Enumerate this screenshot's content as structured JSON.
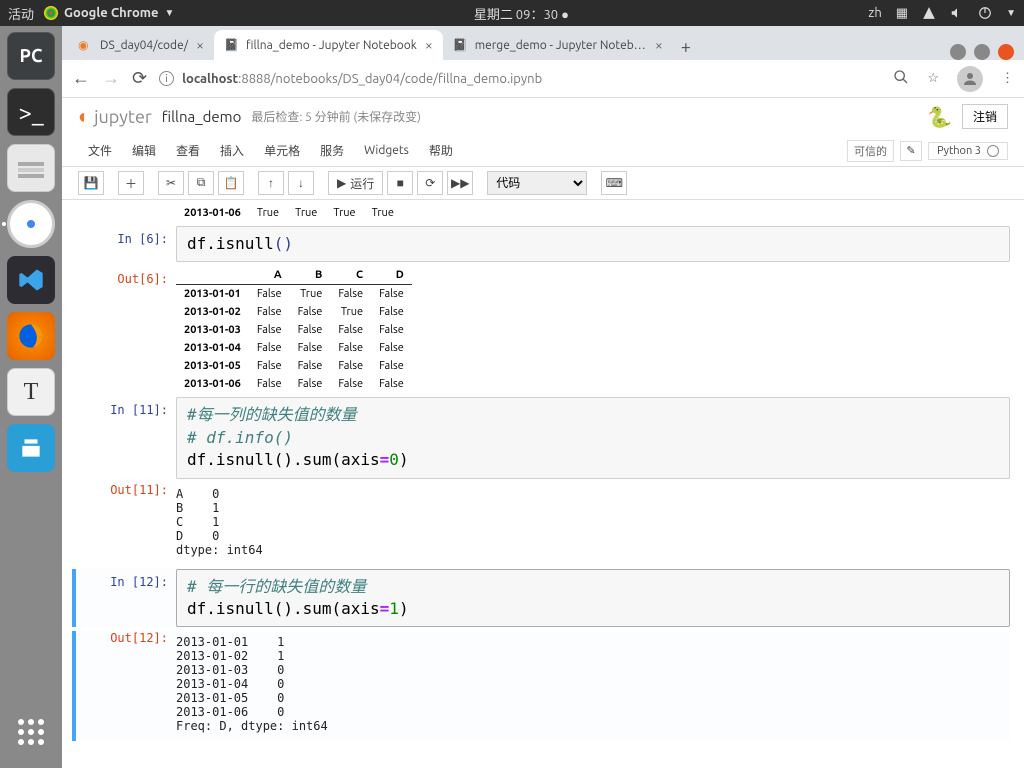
{
  "topbar": {
    "activities": "活动",
    "app_name": "Google Chrome",
    "datetime": "星期二 09：30",
    "lang": "zh"
  },
  "launcher": {
    "pycharm_label": "PC"
  },
  "chrome": {
    "tabs": [
      {
        "title": "DS_day04/code/",
        "favicon_color": "#f37626"
      },
      {
        "title": "fillna_demo - Jupyter Notebook",
        "favicon_color": "#f37626",
        "active": true
      },
      {
        "title": "merge_demo - Jupyter Notebook",
        "favicon_color": "#f37626"
      }
    ],
    "url_host": "localhost",
    "url_port": ":8888",
    "url_path": "/notebooks/DS_day04/code/fillna_demo.ipynb"
  },
  "jupyter": {
    "logo_text": "jupyter",
    "nb_title": "fillna_demo",
    "checkpoint": "最后检查: 5 分钟前",
    "unsaved": "(未保存改变)",
    "logout": "注销",
    "menus": [
      "文件",
      "编辑",
      "查看",
      "插入",
      "单元格",
      "服务",
      "Widgets",
      "帮助"
    ],
    "trusted": "可信的",
    "kernel": "Python 3",
    "run_label": "运行",
    "cell_type": "代码"
  },
  "cells": {
    "partial_out_row": {
      "date": "2013-01-06",
      "A": "True",
      "B": "True",
      "C": "True",
      "D": "True"
    },
    "c6": {
      "in_prompt": "In [6]:",
      "out_prompt": "Out[6]:",
      "code": "df.isnull()",
      "table": {
        "cols": [
          "A",
          "B",
          "C",
          "D"
        ],
        "rows": [
          {
            "idx": "2013-01-01",
            "v": [
              "False",
              "True",
              "False",
              "False"
            ]
          },
          {
            "idx": "2013-01-02",
            "v": [
              "False",
              "False",
              "True",
              "False"
            ]
          },
          {
            "idx": "2013-01-03",
            "v": [
              "False",
              "False",
              "False",
              "False"
            ]
          },
          {
            "idx": "2013-01-04",
            "v": [
              "False",
              "False",
              "False",
              "False"
            ]
          },
          {
            "idx": "2013-01-05",
            "v": [
              "False",
              "False",
              "False",
              "False"
            ]
          },
          {
            "idx": "2013-01-06",
            "v": [
              "False",
              "False",
              "False",
              "False"
            ]
          }
        ]
      }
    },
    "c11": {
      "in_prompt": "In [11]:",
      "out_prompt": "Out[11]:",
      "comment1": "#每一列的缺失值的数量",
      "comment2": "# df.info()",
      "code_prefix": "df.isnull().sum(axis",
      "code_eq": "=",
      "code_arg": "0",
      "code_suffix": ")",
      "output": "A    0\nB    1\nC    1\nD    0\ndtype: int64"
    },
    "c12": {
      "in_prompt": "In [12]:",
      "out_prompt": "Out[12]:",
      "comment1": "# 每一行的缺失值的数量",
      "code_prefix": "df.isnull().sum(axis",
      "code_eq": "=",
      "code_arg": "1",
      "code_suffix": ")",
      "output": "2013-01-01    1\n2013-01-02    1\n2013-01-03    0\n2013-01-04    0\n2013-01-05    0\n2013-01-06    0\nFreq: D, dtype: int64"
    }
  }
}
